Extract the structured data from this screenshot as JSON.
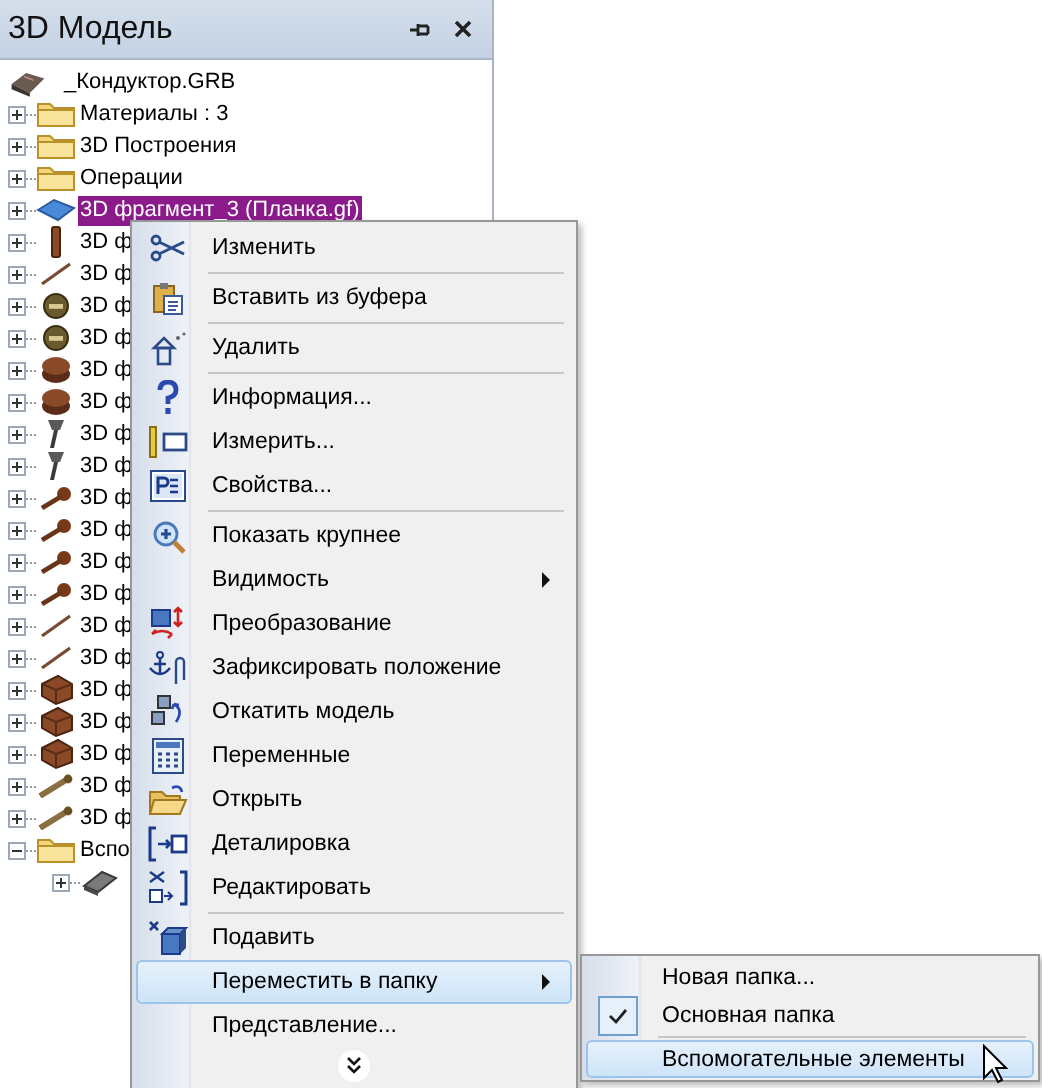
{
  "panel": {
    "title": "3D Модель"
  },
  "tree": {
    "label": "_Кондуктор.GRB",
    "kind": "assembly",
    "children": [
      {
        "label": "Материалы : 3",
        "kind": "folder",
        "expanded": false,
        "selected": false
      },
      {
        "label": "3D Построения",
        "kind": "folder",
        "expanded": false,
        "selected": false
      },
      {
        "label": "Операции",
        "kind": "folder",
        "expanded": false,
        "selected": false
      },
      {
        "label": "3D фрагмент_3 (Планка.gf)",
        "kind": "plate",
        "expanded": false,
        "selected": true
      },
      {
        "label": "3D ф",
        "kind": "rod",
        "expanded": false,
        "selected": false
      },
      {
        "label": "3D ф",
        "kind": "line",
        "expanded": false,
        "selected": false
      },
      {
        "label": "3D ф",
        "kind": "nut",
        "expanded": false,
        "selected": false
      },
      {
        "label": "3D ф",
        "kind": "nut",
        "expanded": false,
        "selected": false
      },
      {
        "label": "3D ф",
        "kind": "cap",
        "expanded": false,
        "selected": false
      },
      {
        "label": "3D ф",
        "kind": "cap",
        "expanded": false,
        "selected": false
      },
      {
        "label": "3D ф",
        "kind": "bolt",
        "expanded": false,
        "selected": false
      },
      {
        "label": "3D ф",
        "kind": "bolt",
        "expanded": false,
        "selected": false
      },
      {
        "label": "3D ф",
        "kind": "pin",
        "expanded": false,
        "selected": false
      },
      {
        "label": "3D ф",
        "kind": "pin",
        "expanded": false,
        "selected": false
      },
      {
        "label": "3D ф",
        "kind": "pin",
        "expanded": false,
        "selected": false
      },
      {
        "label": "3D ф",
        "kind": "pin",
        "expanded": false,
        "selected": false
      },
      {
        "label": "3D ф",
        "kind": "line",
        "expanded": false,
        "selected": false
      },
      {
        "label": "3D ф",
        "kind": "line",
        "expanded": false,
        "selected": false
      },
      {
        "label": "3D ф",
        "kind": "block",
        "expanded": false,
        "selected": false
      },
      {
        "label": "3D ф",
        "kind": "block",
        "expanded": false,
        "selected": false
      },
      {
        "label": "3D ф",
        "kind": "block",
        "expanded": false,
        "selected": false
      },
      {
        "label": "3D ф",
        "kind": "screw",
        "expanded": false,
        "selected": false
      },
      {
        "label": "3D ф",
        "kind": "screw",
        "expanded": false,
        "selected": false
      },
      {
        "label": "Вспо",
        "kind": "folder",
        "expanded": true,
        "selected": false,
        "children": [
          {
            "kind": "beam",
            "expanded": false
          }
        ]
      }
    ]
  },
  "context_menu": {
    "groups": [
      [
        {
          "label": "Изменить",
          "submenu": false,
          "selected": false
        }
      ],
      [
        {
          "label": "Вставить из буфера",
          "submenu": false,
          "selected": false
        }
      ],
      [
        {
          "label": "Удалить",
          "submenu": false,
          "selected": false
        }
      ],
      [
        {
          "label": "Информация...",
          "submenu": false,
          "selected": false
        },
        {
          "label": "Измерить...",
          "submenu": false,
          "selected": false
        },
        {
          "label": "Свойства...",
          "submenu": false,
          "selected": false
        }
      ],
      [
        {
          "label": "Показать крупнее",
          "submenu": false,
          "selected": false
        },
        {
          "label": "Видимость",
          "submenu": true,
          "selected": false
        },
        {
          "label": "Преобразование",
          "submenu": false,
          "selected": false
        },
        {
          "label": "Зафиксировать положение",
          "submenu": false,
          "selected": false
        },
        {
          "label": "Откатить модель",
          "submenu": false,
          "selected": false
        },
        {
          "label": "Переменные",
          "submenu": false,
          "selected": false
        },
        {
          "label": "Открыть",
          "submenu": false,
          "selected": false
        },
        {
          "label": "Деталировка",
          "submenu": false,
          "selected": false
        },
        {
          "label": "Редактировать",
          "submenu": false,
          "selected": false
        }
      ],
      [
        {
          "label": "Подавить",
          "submenu": false,
          "selected": false
        },
        {
          "label": "Переместить в папку",
          "submenu": true,
          "selected": true
        },
        {
          "label": "Представление...",
          "submenu": false,
          "selected": false
        }
      ]
    ]
  },
  "submenu": {
    "groups": [
      [
        {
          "label": "Новая папка...",
          "checked": false,
          "selected": false
        },
        {
          "label": "Основная папка",
          "checked": true,
          "selected": false
        }
      ],
      [
        {
          "label": "Вспомогательные элементы",
          "checked": false,
          "selected": true
        }
      ]
    ]
  }
}
